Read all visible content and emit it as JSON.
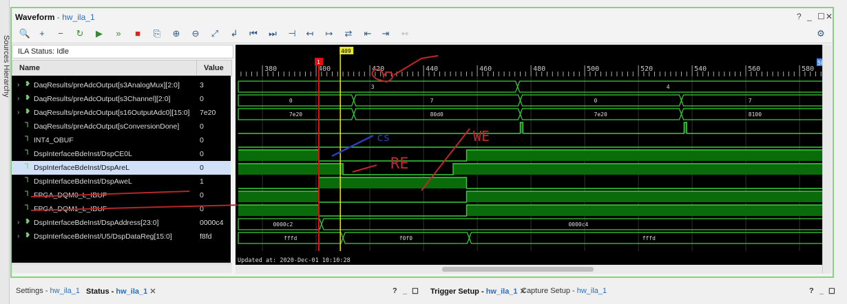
{
  "side_tab": {
    "label": "Sources Hierarchy"
  },
  "window": {
    "title": "Waveform",
    "separator": " - ",
    "device": "hw_ila_1",
    "help": "?",
    "minimize": "_",
    "restore": "☐",
    "close": "✕"
  },
  "toolbar": {
    "buttons": [
      {
        "name": "search",
        "glyph": "🔍"
      },
      {
        "name": "add",
        "glyph": "+"
      },
      {
        "name": "remove",
        "glyph": "−"
      },
      {
        "name": "run-trigger-immediate",
        "glyph": "↻"
      },
      {
        "name": "run-trigger",
        "glyph": "▶"
      },
      {
        "name": "run-continuous",
        "glyph": "»"
      },
      {
        "name": "stop",
        "glyph": "■"
      },
      {
        "name": "export",
        "glyph": "⎘"
      },
      {
        "name": "zoom-in",
        "glyph": "⊕"
      },
      {
        "name": "zoom-out",
        "glyph": "⊖"
      },
      {
        "name": "zoom-fit",
        "glyph": "⤢"
      },
      {
        "name": "go-to-cursor",
        "glyph": "↲"
      },
      {
        "name": "go-to-start",
        "glyph": "⏮"
      },
      {
        "name": "go-to-end",
        "glyph": "⏭"
      },
      {
        "name": "add-marker",
        "glyph": "⊣"
      },
      {
        "name": "prev-transition",
        "glyph": "↤"
      },
      {
        "name": "next-transition",
        "glyph": "↦"
      },
      {
        "name": "swap-cursors",
        "glyph": "⇄"
      },
      {
        "name": "prev-marker",
        "glyph": "⇤"
      },
      {
        "name": "next-marker",
        "glyph": "⇥"
      },
      {
        "name": "snap",
        "glyph": "⇿"
      }
    ],
    "settings_icon": "⚙"
  },
  "ila_status": "ILA Status:  Idle",
  "columns": {
    "name": "Name",
    "value": "Value"
  },
  "signals": [
    {
      "name": "DaqResults/preAdcOutput[s3AnalogMux][2:0]",
      "value": "3",
      "bus": true
    },
    {
      "name": "DaqResults/preAdcOutput[s3Channel][2:0]",
      "value": "0",
      "bus": true
    },
    {
      "name": "DaqResults/preAdcOutput[s16OutputAdc0][15:0]",
      "value": "7e20",
      "bus": true
    },
    {
      "name": "DaqResults/preAdcOutput[sConversionDone]",
      "value": "0",
      "bus": false
    },
    {
      "name": "INT4_OBUF",
      "value": "0",
      "bus": false
    },
    {
      "name": "DspInterfaceBdeInst/DspCE0L",
      "value": "0",
      "bus": false
    },
    {
      "name": "DspInterfaceBdeInst/DspAreL",
      "value": "0",
      "bus": false,
      "selected": true
    },
    {
      "name": "DspInterfaceBdeInst/DspAweL",
      "value": "1",
      "bus": false
    },
    {
      "name": "FPGA_DQM0_L_IBUF",
      "value": "0",
      "bus": false
    },
    {
      "name": "FPGA_DQM1_L_IBUF",
      "value": "0",
      "bus": false
    },
    {
      "name": "DspInterfaceBdeInst/DspAddress[23:0]",
      "value": "0000c4",
      "bus": true
    },
    {
      "name": "DspInterfaceBdeInst/U5/DspDataReg[15:0]",
      "value": "f8fd",
      "bus": true
    }
  ],
  "waveform": {
    "ruler_labels": [
      "380",
      "400",
      "420",
      "440",
      "460",
      "480",
      "500",
      "520",
      "540",
      "560",
      "580"
    ],
    "cursor_red_label": "1",
    "cursor_yellow_label": "409",
    "end_marker_label": "580",
    "updated_at": "Updated at: 2020-Dec-01 10:10:28",
    "bus_labels": [
      [
        "3",
        "4"
      ],
      [
        "0",
        "7",
        "0",
        "7"
      ],
      [
        "7e20",
        "80d0",
        "7e20",
        "8100"
      ],
      [
        "0000c2",
        "0000c4"
      ],
      [
        "fffd",
        "f0f0",
        "fffd"
      ]
    ],
    "annotations": {
      "clk": "CLK_num (60M)",
      "cs": "cs",
      "re": "RE",
      "we": "WE"
    },
    "colors": {
      "wave": "#39d339",
      "fill": "#0a6b0a",
      "cursor_red": "#e01010",
      "cursor_yellow": "#e8e820",
      "marker": "#3a8cff",
      "ink_red": "#c0282a",
      "ink_blue": "#2a3fb8"
    }
  },
  "bottom_tabs": [
    {
      "label": "Settings",
      "device": "hw_ila_1",
      "active": false
    },
    {
      "label": "Status",
      "device": "hw_ila_1",
      "active": true
    },
    {
      "label": "Trigger Setup",
      "device": "hw_ila_1",
      "active": true
    },
    {
      "label": "Capture Setup",
      "device": "hw_ila_1",
      "active": false
    }
  ],
  "bottom_controls": {
    "help": "?",
    "minimize": "_",
    "restore": "☐",
    "close": "✕"
  }
}
